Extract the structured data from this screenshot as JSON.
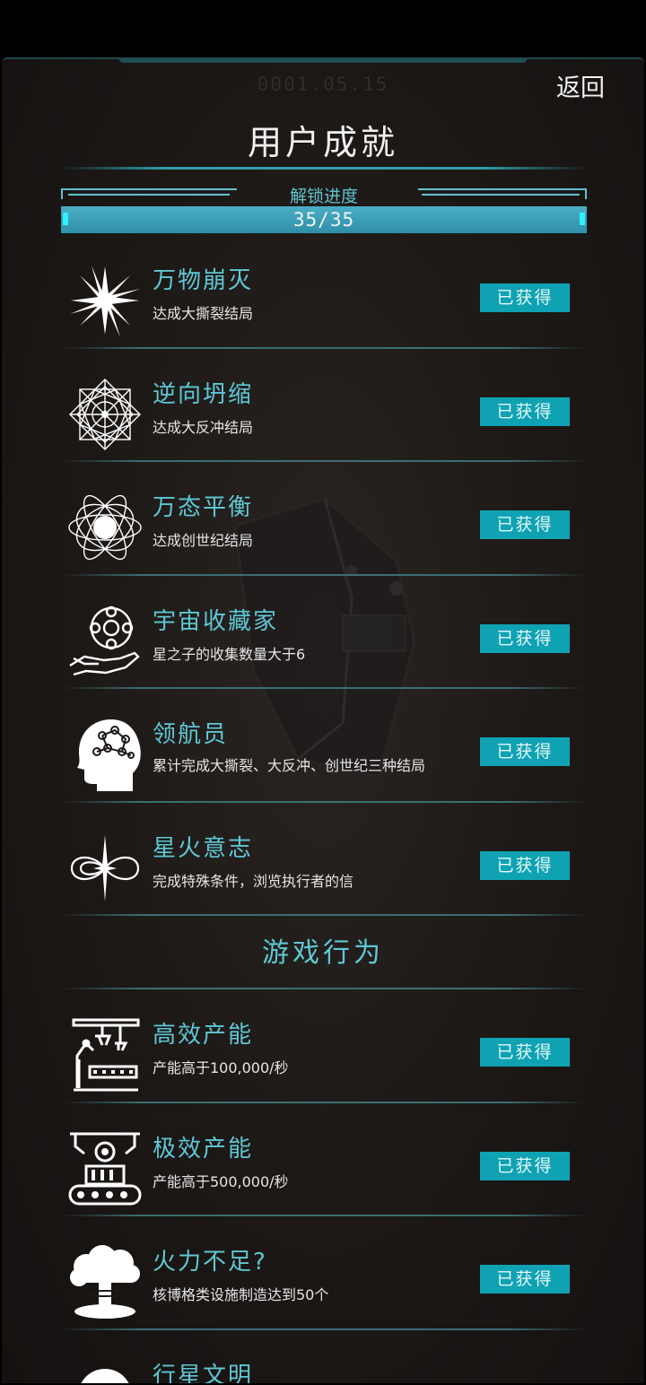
{
  "header": {
    "date": "0001.05.15",
    "back_label": "返回",
    "title": "用户成就"
  },
  "progress": {
    "label": "解锁进度",
    "text": "35/35",
    "fraction": 1.0
  },
  "achievements": [
    {
      "name": "万物崩灭",
      "desc": "达成大撕裂结局",
      "status": "已获得",
      "icon": "starburst-icon"
    },
    {
      "name": "逆向坍缩",
      "desc": "达成大反冲结局",
      "status": "已获得",
      "icon": "mandala-icon"
    },
    {
      "name": "万态平衡",
      "desc": "达成创世纪结局",
      "status": "已获得",
      "icon": "orbit-icon"
    },
    {
      "name": "宇宙收藏家",
      "desc": "星之子的收集数量大于6",
      "status": "已获得",
      "icon": "hand-globe-icon"
    },
    {
      "name": "领航员",
      "desc": "累计完成大撕裂、大反冲、创世纪三种结局",
      "status": "已获得",
      "icon": "brain-head-icon"
    },
    {
      "name": "星火意志",
      "desc": "完成特殊条件，浏览执行者的信",
      "status": "已获得",
      "icon": "infinity-star-icon"
    }
  ],
  "section2": {
    "title": "游戏行为"
  },
  "behaviors": [
    {
      "name": "高效产能",
      "desc": "产能高于100,000/秒",
      "status": "已获得",
      "icon": "robot-arm-icon"
    },
    {
      "name": "极效产能",
      "desc": "产能高于500,000/秒",
      "status": "已获得",
      "icon": "factory-gear-icon"
    },
    {
      "name": "火力不足?",
      "desc": "核博格类设施制造达到50个",
      "status": "已获得",
      "icon": "mushroom-cloud-icon"
    }
  ],
  "partial_item": {
    "name": "行星文明"
  }
}
